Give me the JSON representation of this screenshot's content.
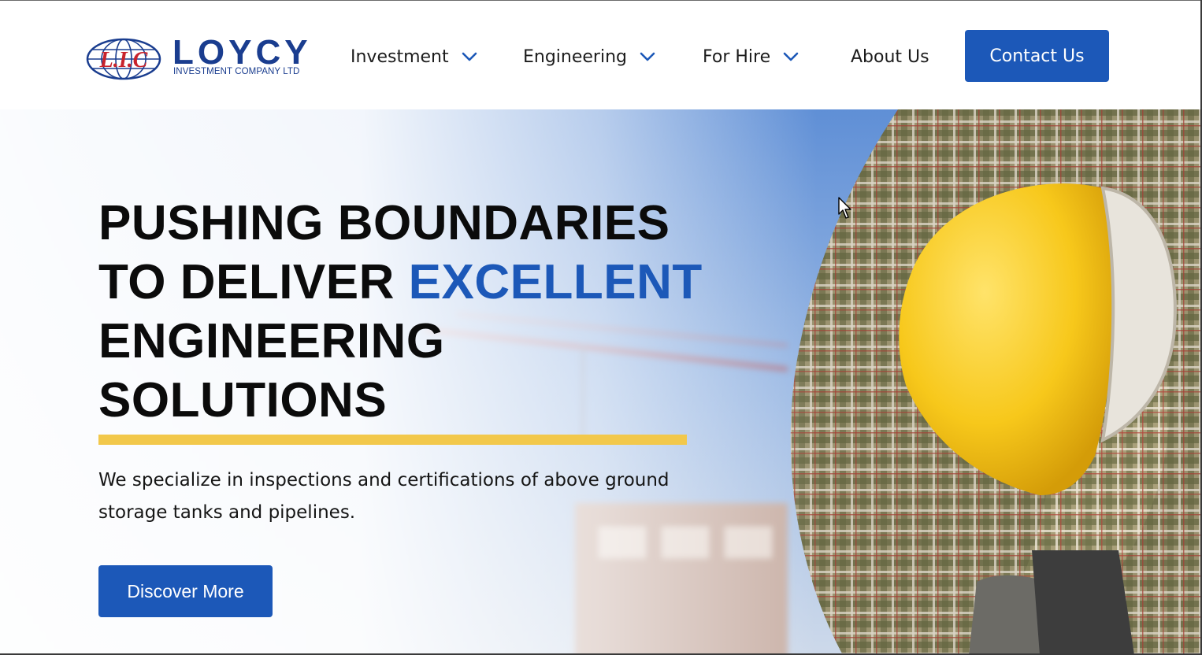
{
  "brand": {
    "name": "LOYCY",
    "subtitle": "INVESTMENT COMPANY LTD",
    "emblem_text": "L.I.C",
    "colors": {
      "primary": "#1c58b8",
      "logo_blue": "#1a3d8f",
      "logo_red": "#c8232c",
      "accent_yellow": "#f2c84b"
    }
  },
  "nav": {
    "items": [
      {
        "label": "Investment",
        "has_dropdown": true,
        "icon": "chevron-down-icon"
      },
      {
        "label": "Engineering",
        "has_dropdown": true,
        "icon": "chevron-down-icon"
      },
      {
        "label": "For Hire",
        "has_dropdown": true,
        "icon": "chevron-down-icon"
      },
      {
        "label": "About Us",
        "has_dropdown": false
      }
    ],
    "cta_label": "Contact Us"
  },
  "hero": {
    "headline_line1": "PUSHING BOUNDARIES",
    "headline_line2_start": "TO DELIVER ",
    "headline_accent": "EXCELLENT",
    "headline_line3": "ENGINEERING",
    "headline_line4": "SOLUTIONS",
    "intro": "We specialize in inspections and certifications of above ground storage tanks and pipelines.",
    "button_label": "Discover More",
    "image_subject": "construction worker holding yellow hard hat"
  }
}
